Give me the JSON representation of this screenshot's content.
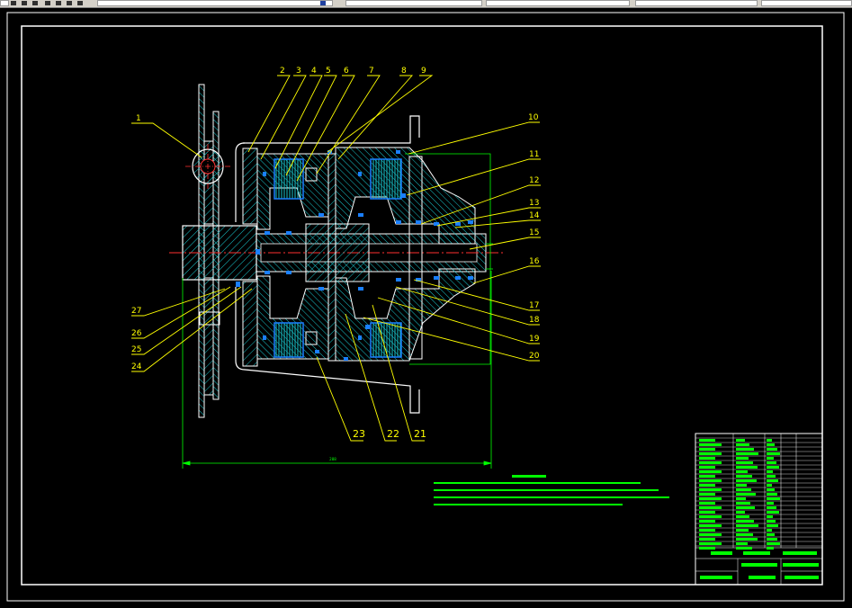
{
  "toolbar": {},
  "drawing": {
    "balloons": {
      "n1": "1",
      "n2": "2",
      "n3": "3",
      "n4": "4",
      "n5": "5",
      "n6": "6",
      "n7": "7",
      "n8": "8",
      "n9": "9",
      "n10": "10",
      "n11": "11",
      "n12": "12",
      "n13": "13",
      "n14": "14",
      "n15": "15",
      "n16": "16",
      "n17": "17",
      "n18": "18",
      "n19": "19",
      "n20": "20",
      "n21": "21",
      "n22": "22",
      "n23": "23",
      "n24": "24",
      "n25": "25",
      "n26": "26",
      "n27": "27"
    },
    "dimension_bottom": "288"
  },
  "colors": {
    "background": "#000000",
    "frame": "#ffffff",
    "outline": "#ffffff",
    "leader": "#ffff00",
    "hatch": "#19c5cc",
    "bolt": "#1a7fff",
    "centerline": "#ff3030",
    "dimension": "#00ff00",
    "text": "#00ff00"
  }
}
